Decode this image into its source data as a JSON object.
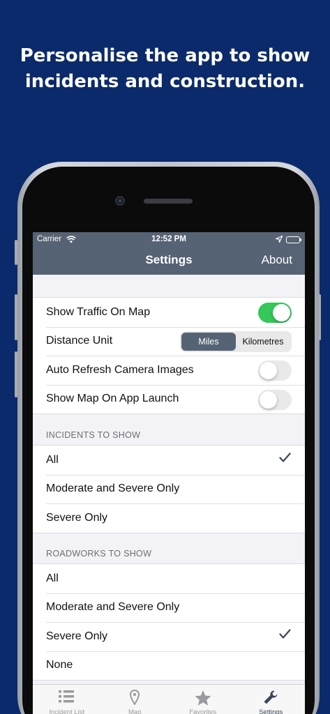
{
  "headline": {
    "line1": "Personalise the app to show",
    "line2": "incidents and construction."
  },
  "status": {
    "carrier": "Carrier",
    "time": "12:52 PM"
  },
  "navbar": {
    "title": "Settings",
    "about": "About"
  },
  "settings": {
    "rows": [
      {
        "label": "Show Traffic On Map",
        "toggle": true
      },
      {
        "label": "Distance Unit",
        "options": [
          "Miles",
          "Kilometres"
        ],
        "selected": "Miles"
      },
      {
        "label": "Auto Refresh Camera Images",
        "toggle": false
      },
      {
        "label": "Show Map On App Launch",
        "toggle": false
      }
    ]
  },
  "incidents": {
    "header": "INCIDENTS TO SHOW",
    "items": [
      {
        "label": "All",
        "checked": true
      },
      {
        "label": "Moderate and Severe Only",
        "checked": false
      },
      {
        "label": "Severe Only",
        "checked": false
      }
    ]
  },
  "roadworks": {
    "header": "ROADWORKS TO SHOW",
    "items": [
      {
        "label": "All",
        "checked": false
      },
      {
        "label": "Moderate and Severe Only",
        "checked": false
      },
      {
        "label": "Severe Only",
        "checked": true
      },
      {
        "label": "None",
        "checked": false
      }
    ]
  },
  "tabs": [
    {
      "label": "Incident List",
      "icon": "list-icon",
      "active": false
    },
    {
      "label": "Map",
      "icon": "map-pin-icon",
      "active": false
    },
    {
      "label": "Favorites",
      "icon": "star-icon",
      "active": false
    },
    {
      "label": "Settings",
      "icon": "wrench-icon",
      "active": true
    }
  ],
  "colors": {
    "background": "#0b2a6b",
    "navbar": "#566374",
    "toggle_on": "#34c759",
    "check": "#3a4658"
  }
}
